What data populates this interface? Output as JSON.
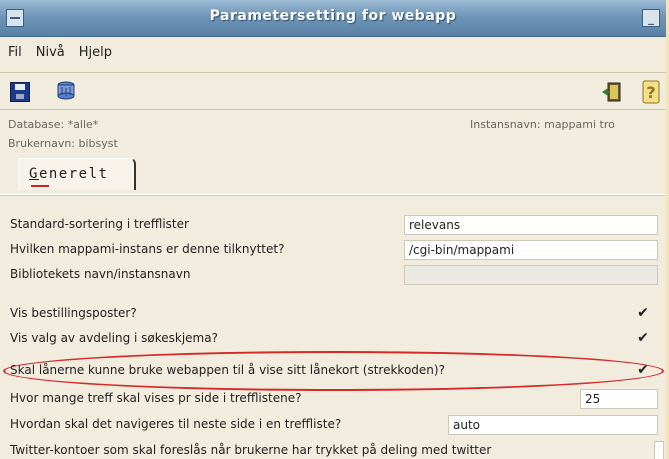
{
  "window": {
    "title": "Parametersetting for webapp"
  },
  "menu": {
    "items": [
      "Fil",
      "Nivå",
      "Hjelp"
    ]
  },
  "info": {
    "database": "Database: *alle*",
    "instance": "Instansnavn: mappami tro",
    "user": "Brukernavn: bibsyst"
  },
  "tabs": [
    {
      "label": "Generelt"
    }
  ],
  "form": {
    "rows": [
      {
        "label": "Standard-sortering i trefflister",
        "value": "relevans"
      },
      {
        "label": "Hvilken mappami-instans er denne tilknyttet?",
        "value": "/cgi-bin/mappami"
      },
      {
        "label": "Bibliotekets navn/instansnavn",
        "value": ""
      },
      {
        "label": "Vis bestillingsposter?",
        "checked": "✔"
      },
      {
        "label": "Vis valg av avdeling i søkeskjema?",
        "checked": "✔"
      },
      {
        "label": "Skal lånerne kunne bruke webappen til å vise sitt lånekort (strekkoden)?",
        "checked": "✔"
      },
      {
        "label": "Hvor mange treff skal vises pr side i trefflistene?",
        "value": "25"
      },
      {
        "label": "Hvordan skal det navigeres til neste side i en treffliste?",
        "value": "auto"
      },
      {
        "label": "Twitter-kontoer som skal foreslås når brukerne har trykket på deling med twitter",
        "value": ""
      }
    ]
  },
  "colors": {
    "titlebar": "#6f95b8",
    "highlight": "#d32a2a",
    "window_bg": "#f2ecdf"
  }
}
